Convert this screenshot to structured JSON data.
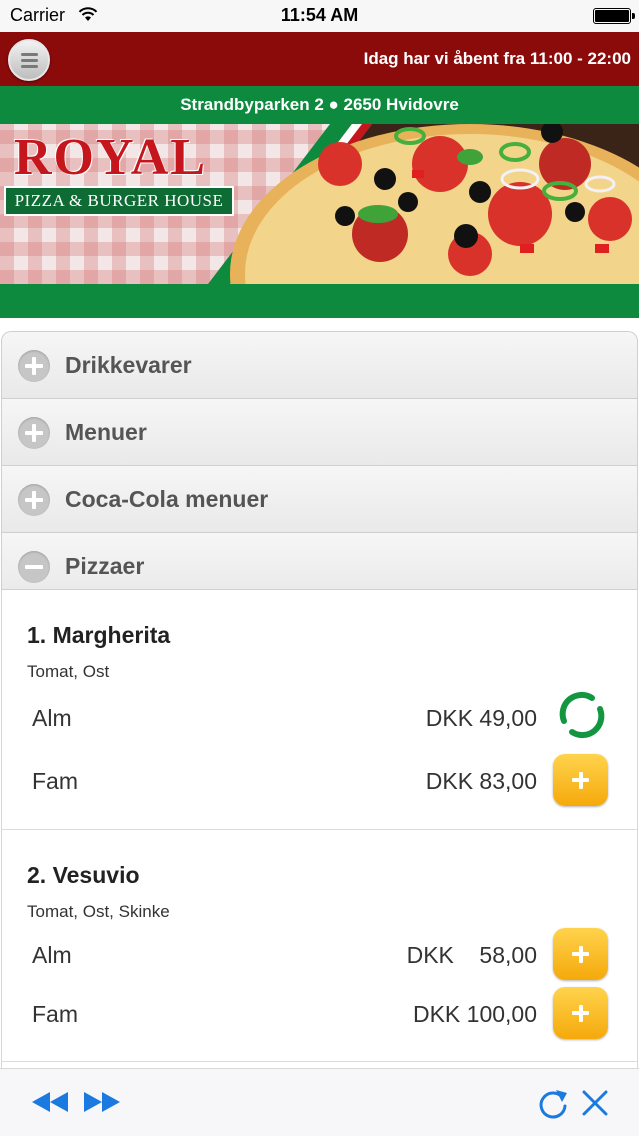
{
  "status_bar": {
    "carrier": "Carrier",
    "time": "11:54 AM"
  },
  "header": {
    "opening_hours": "Idag har vi åbent fra 11:00 - 22:00",
    "address": "Strandbyparken 2 ● 2650 Hvidovre"
  },
  "banner": {
    "logo_title": "ROYAL",
    "logo_subtitle": "PIZZA & BURGER HOUSE"
  },
  "categories": [
    {
      "label": "Drikkevarer",
      "icon": "plus-circle-icon"
    },
    {
      "label": "Menuer",
      "icon": "plus-circle-icon"
    },
    {
      "label": "Coca-Cola menuer",
      "icon": "plus-circle-icon"
    },
    {
      "label": "Pizzaer",
      "icon": "minus-circle-icon",
      "expanded": true
    }
  ],
  "products": [
    {
      "name": "1. Margherita",
      "description": "Tomat, Ost",
      "options": [
        {
          "size": "Alm",
          "price": "DKK 49,00",
          "state": "loading"
        },
        {
          "size": "Fam",
          "price": "DKK 83,00",
          "state": "add"
        }
      ]
    },
    {
      "name": "2. Vesuvio",
      "description": "Tomat, Ost, Skinke",
      "options": [
        {
          "size": "Alm",
          "price": "DKK    58,00",
          "state": "add"
        },
        {
          "size": "Fam",
          "price": "DKK 100,00",
          "state": "add"
        }
      ]
    }
  ],
  "toolbar": {
    "icons": [
      "rewind-icon",
      "fast-forward-icon",
      "refresh-icon",
      "close-icon"
    ]
  },
  "colors": {
    "header_red": "#8b0a0a",
    "green": "#0e8a3f",
    "button_yellow": "#f5a90b",
    "toolbar_blue": "#1a7ae0"
  }
}
